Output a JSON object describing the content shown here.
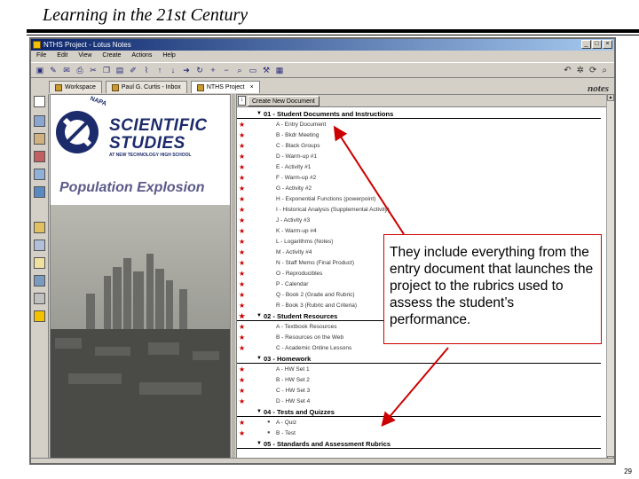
{
  "slide": {
    "title": "Learning in the 21st Century",
    "page_number": "29"
  },
  "window": {
    "title": "NTHS Project - Lotus Notes",
    "menu": [
      "File",
      "Edit",
      "View",
      "Create",
      "Actions",
      "Help"
    ],
    "tabs": [
      {
        "label": "Workspace"
      },
      {
        "label": "Paul G. Curtis - Inbox"
      },
      {
        "label": "NTHS Project"
      }
    ],
    "brand": "notes"
  },
  "left_panel": {
    "logo_arc": "NAPA",
    "brand_line1": "SCIENTIFIC",
    "brand_line2": "STUDIES",
    "brand_sub": "AT NEW TECHNOLOGY HIGH SCHOOL",
    "project_title": "Population Explosion"
  },
  "doc_panel": {
    "action_button": "Create New Document",
    "rows": [
      {
        "type": "cat",
        "label": "01 - Student Documents and Instructions",
        "star": false
      },
      {
        "type": "item",
        "label": "A - Entry Document",
        "star": true
      },
      {
        "type": "item",
        "label": "B - Bkdr Meeting",
        "star": true
      },
      {
        "type": "item",
        "label": "C - Black Groups",
        "star": true
      },
      {
        "type": "item",
        "label": "D - Warm-up #1",
        "star": true
      },
      {
        "type": "item",
        "label": "E - Activity #1",
        "star": true
      },
      {
        "type": "item",
        "label": "F - Warm-up #2",
        "star": true
      },
      {
        "type": "item",
        "label": "G - Activity #2",
        "star": true
      },
      {
        "type": "item",
        "label": "H - Exponential Functions (powerpoint)",
        "star": true
      },
      {
        "type": "item",
        "label": "I - Historical Analysis (Supplemental Activity)",
        "star": true
      },
      {
        "type": "item",
        "label": "J - Activity #3",
        "star": true
      },
      {
        "type": "item",
        "label": "K - Warm-up #4",
        "star": true
      },
      {
        "type": "item",
        "label": "L - Logarithms (Notes)",
        "star": true
      },
      {
        "type": "item",
        "label": "M - Activity #4",
        "star": true
      },
      {
        "type": "item",
        "label": "N - Staff Memo (Final Product)",
        "star": true
      },
      {
        "type": "item",
        "label": "O - Reproducibles",
        "star": true
      },
      {
        "type": "item",
        "label": "P - Calendar",
        "star": true
      },
      {
        "type": "item",
        "label": "Q - Book 2 (Grade and Rubric)",
        "star": true
      },
      {
        "type": "item",
        "label": "R - Book 3 (Rubric and Criteria)",
        "star": true
      },
      {
        "type": "cat",
        "label": "02 - Student Resources",
        "star": true
      },
      {
        "type": "item",
        "label": "A - Textbook Resources",
        "star": true
      },
      {
        "type": "item",
        "label": "B - Resources on the Web",
        "star": true
      },
      {
        "type": "item",
        "label": "C - Academic Online Lessons",
        "star": true
      },
      {
        "type": "cat",
        "label": "03 - Homework",
        "star": false
      },
      {
        "type": "item",
        "label": "A - HW Set 1",
        "star": true
      },
      {
        "type": "item",
        "label": "B - HW Set 2",
        "star": true
      },
      {
        "type": "item",
        "label": "C - HW Set 3",
        "star": true
      },
      {
        "type": "item",
        "label": "D - HW Set 4",
        "star": true
      },
      {
        "type": "cat",
        "label": "04 - Tests and Quizzes",
        "star": false
      },
      {
        "type": "item",
        "label": "A - Quiz",
        "star": true,
        "lock": true
      },
      {
        "type": "item",
        "label": "B - Test",
        "star": true,
        "lock": true
      },
      {
        "type": "cat",
        "label": "05 - Standards and Assessment Rubrics",
        "star": false
      }
    ]
  },
  "callout": {
    "text": "They include everything from the entry document that launches the project to the rubrics used to assess the student’s performance."
  }
}
